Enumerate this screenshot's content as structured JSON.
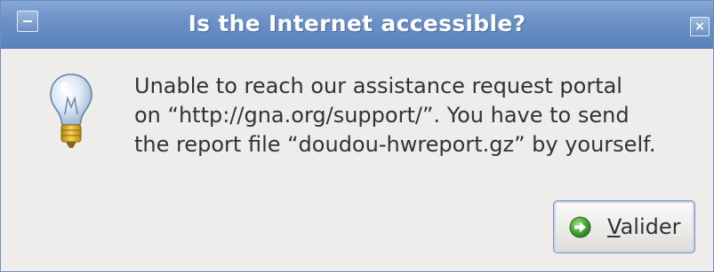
{
  "dialog": {
    "title": "Is the Internet accessible?",
    "close_glyph": "×",
    "icon": "lightbulb-icon",
    "message_lines": [
      "Unable to reach our assistance request portal",
      "on “http://gna.org/support/”. You have to send",
      "the report file “doudou-hwreport.gz” by yourself."
    ]
  },
  "button": {
    "mnemonic": "V",
    "rest": "alider",
    "icon": "green-arrow-icon"
  },
  "colors": {
    "titlebar": "#6a90c6",
    "dialog_bg": "#efedeb",
    "text": "#2e3436",
    "ok_icon": "#4aa63a"
  }
}
